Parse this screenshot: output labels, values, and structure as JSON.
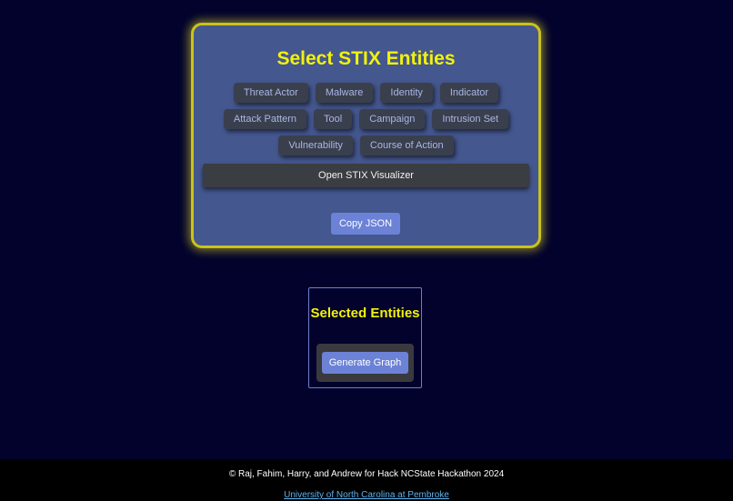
{
  "selector": {
    "title": "Select STIX Entities",
    "entities_row1": [
      "Threat Actor",
      "Malware",
      "Identity",
      "Indicator"
    ],
    "entities_row2": [
      "Attack Pattern",
      "Tool",
      "Campaign",
      "Intrusion Set"
    ],
    "entities_row3": [
      "Vulnerability",
      "Course of Action"
    ],
    "visualizer_label": "Open STIX Visualizer",
    "copy_label": "Copy JSON"
  },
  "selected": {
    "title": "Selected Entities",
    "generate_label": "Generate Graph"
  },
  "footer": {
    "credit": "© Raj, Fahim, Harry, and Andrew for Hack NCState Hackathon 2024",
    "link_text": "University of North Carolina at Pembroke"
  },
  "colors": {
    "background": "#02022c",
    "panel": "#44578f",
    "panel_border": "#c9c31a",
    "title": "#f2f20a",
    "accent_button": "#6c82d6",
    "link": "#5fb3f0"
  }
}
